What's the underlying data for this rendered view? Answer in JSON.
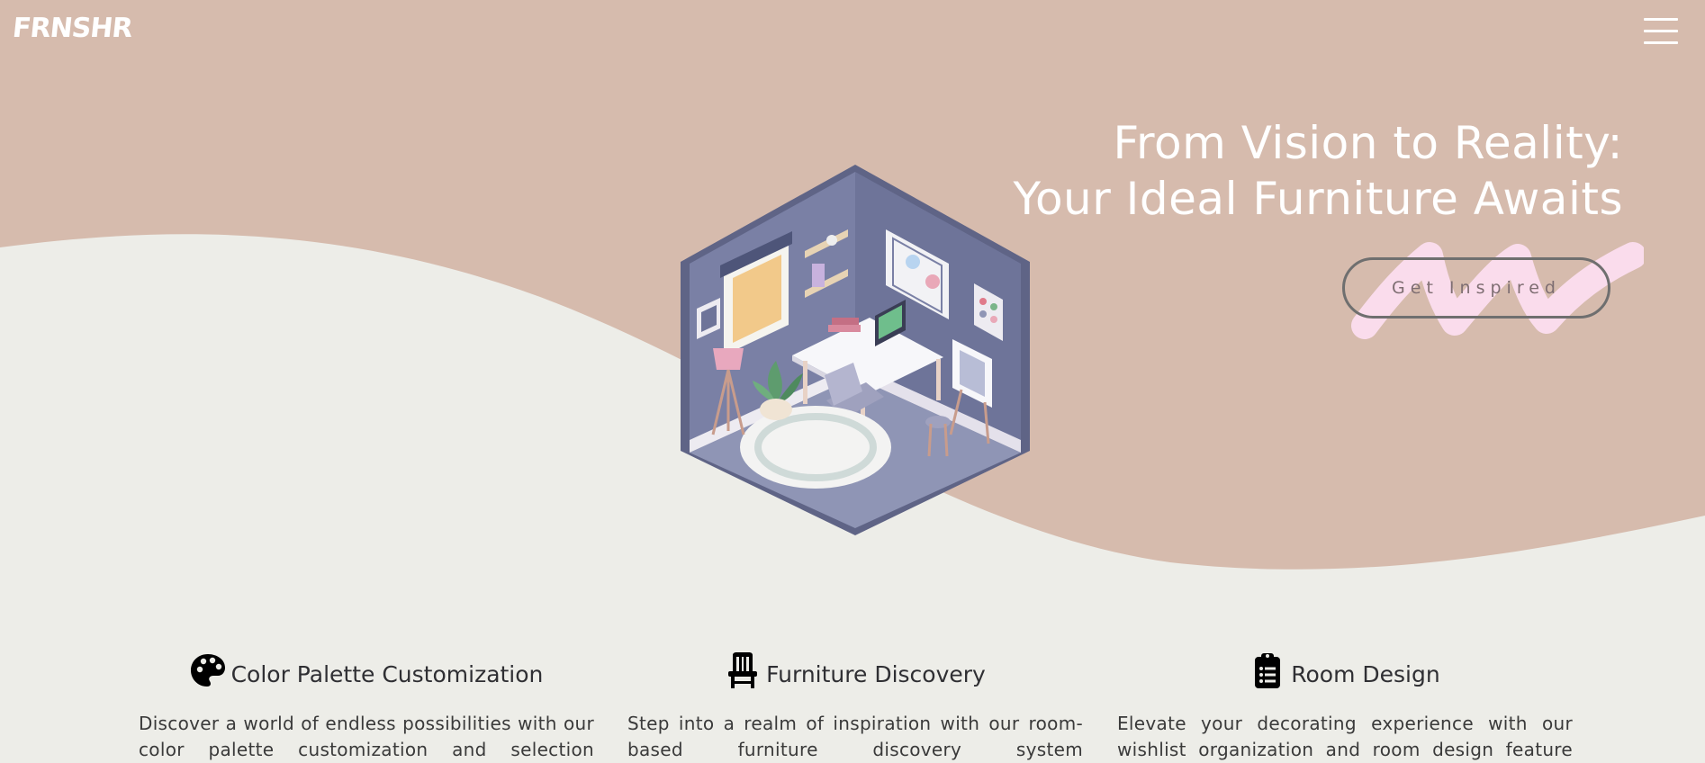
{
  "brand": {
    "logo_text": "FRNSHR"
  },
  "nav": {
    "menu_icon": "hamburger-menu-icon"
  },
  "hero": {
    "headline_line1": "From Vision to Reality:",
    "headline_line2": "Your Ideal Furniture Awaits",
    "cta_label": "Get Inspired",
    "illustration": "isometric-home-office-room"
  },
  "features": [
    {
      "icon": "palette-icon",
      "title": "Color Palette Customization",
      "description": "Discover a world of endless possibilities with our color palette customization and selection"
    },
    {
      "icon": "chair-icon",
      "title": "Furniture Discovery",
      "description": "Step into a realm of inspiration with our room-based furniture discovery system"
    },
    {
      "icon": "clipboard-list-icon",
      "title": "Room Design",
      "description": "Elevate your decorating experience with our wishlist organization and room design feature"
    }
  ],
  "colors": {
    "hero_background": "#D6BBAD",
    "page_background": "#EDEDE8",
    "brush_accent": "#FADCEC",
    "text_white": "#FFFFFF"
  }
}
